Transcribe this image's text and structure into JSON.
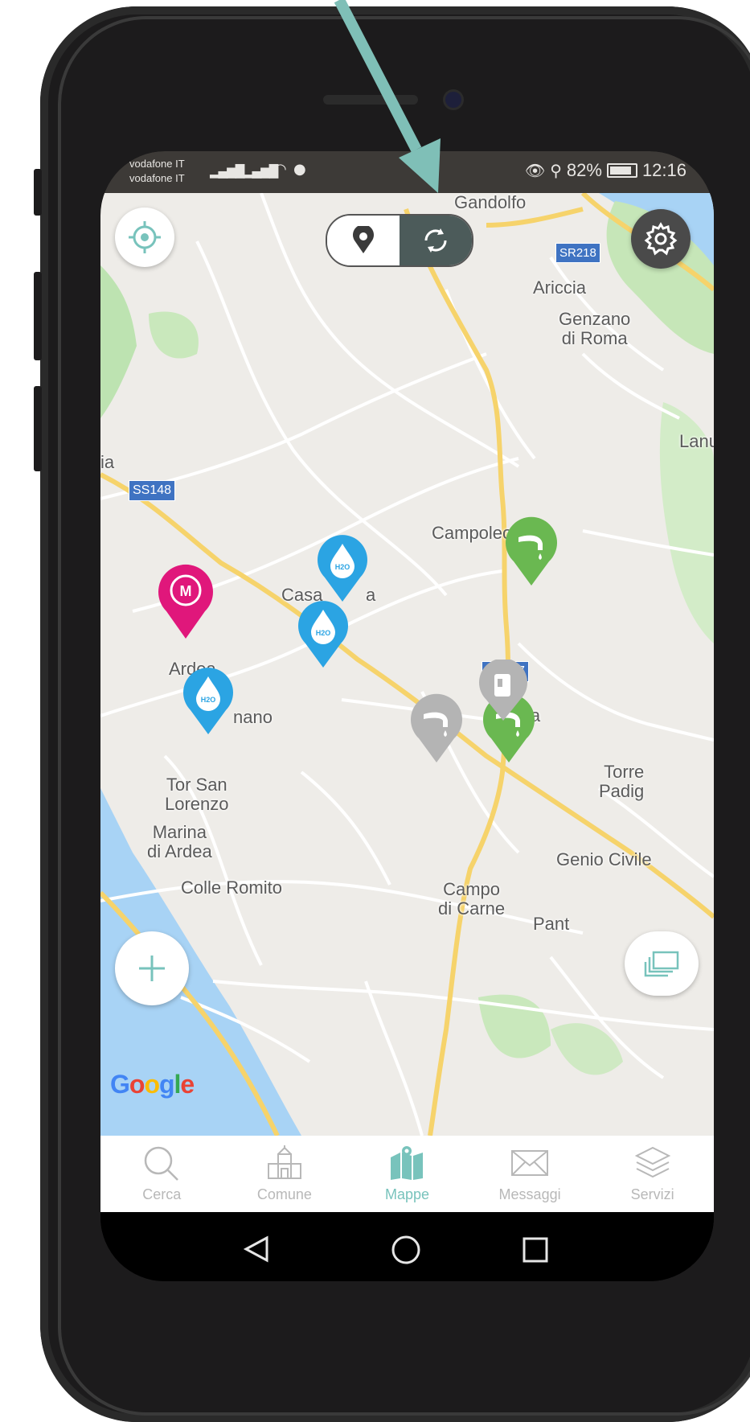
{
  "status": {
    "carrier_1": "vodafone IT",
    "carrier_2": "vodafone IT",
    "battery": "82%",
    "time": "12:16"
  },
  "map": {
    "places": [
      {
        "id": "gandolfo",
        "text": "Gandolfo"
      },
      {
        "id": "pavona",
        "text": "Pavona"
      },
      {
        "id": "ariccia",
        "text": "Ariccia"
      },
      {
        "id": "genzano",
        "text": "Genzano\ndi Roma"
      },
      {
        "id": "lanuv",
        "text": "Lanuv"
      },
      {
        "id": "ia",
        "text": "ia"
      },
      {
        "id": "campoleone",
        "text": "Campoleone"
      },
      {
        "id": "casa",
        "text": "Casa"
      },
      {
        "id": "casa_a",
        "text": "a"
      },
      {
        "id": "ardea",
        "text": "Ardea"
      },
      {
        "id": "nano",
        "text": "nano"
      },
      {
        "id": "ia2",
        "text": "ia"
      },
      {
        "id": "torsanlorenzo",
        "text": "Tor San\nLorenzo"
      },
      {
        "id": "marina",
        "text": "Marina\ndi Ardea"
      },
      {
        "id": "colleromito",
        "text": "Colle Romito"
      },
      {
        "id": "torre",
        "text": "Torre\nPadig"
      },
      {
        "id": "genio",
        "text": "Genio Civile"
      },
      {
        "id": "campodicarne",
        "text": "Campo\ndi Carne"
      },
      {
        "id": "pant",
        "text": "Pant"
      }
    ],
    "shields": {
      "ss148": "SS148",
      "sr207": "SR207",
      "sr218": "SR218"
    },
    "pin_labels": {
      "h2o": "H2O",
      "metro": "M"
    },
    "google": "Google"
  },
  "tabs": [
    {
      "label": "Cerca",
      "icon": "search-icon",
      "active": false
    },
    {
      "label": "Comune",
      "icon": "town-hall-icon",
      "active": false
    },
    {
      "label": "Mappe",
      "icon": "map-icon",
      "active": true
    },
    {
      "label": "Messaggi",
      "icon": "mail-icon",
      "active": false
    },
    {
      "label": "Servizi",
      "icon": "layers-icon",
      "active": false
    }
  ],
  "colors": {
    "accent": "#78c3bc",
    "pin_blue": "#2ba4e3",
    "pin_green": "#6ab851",
    "pin_magenta": "#e0177b",
    "pin_grey": "#b4b4b4",
    "toggle_dark": "#4c5b5a"
  }
}
